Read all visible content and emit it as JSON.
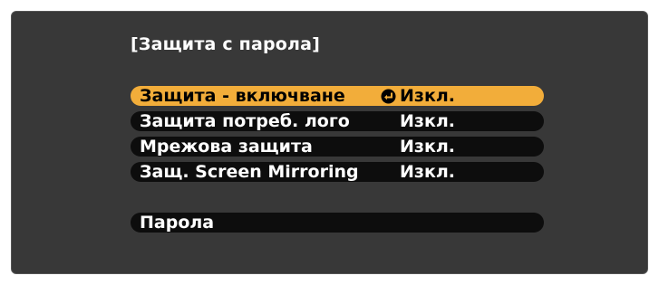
{
  "menu": {
    "title": "[Защита с парола]",
    "items": [
      {
        "label": "Защита - включване",
        "value": "Изкл.",
        "selected": true,
        "icon": "enter-icon"
      },
      {
        "label": "Защита потреб. лого",
        "value": "Изкл."
      },
      {
        "label": "Мрежова защита",
        "value": "Изкл."
      },
      {
        "label": "Защ. Screen Mirroring",
        "value": "Изкл."
      }
    ],
    "password": {
      "label": "Парола"
    }
  },
  "colors": {
    "background": "#383838",
    "row": "#0d0d0d",
    "highlight": "#f2ad3a",
    "text": "#ffffff",
    "highlight_text": "#000000"
  }
}
